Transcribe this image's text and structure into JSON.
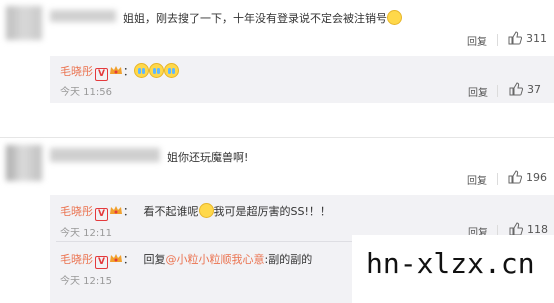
{
  "comments": [
    {
      "text": "姐姐，刚去搜了一下，十年没有登录说不定会被注销号",
      "reply_label": "回复",
      "likes": "311",
      "replies": [
        {
          "nickname": "毛晓彤",
          "colon": "：",
          "time": "今天 11:56",
          "reply_label": "回复",
          "likes": "37",
          "emoji_count": 3
        }
      ]
    },
    {
      "text": "姐你还玩魔兽啊!",
      "reply_label": "回复",
      "likes": "196",
      "replies": [
        {
          "nickname": "毛晓彤",
          "colon": "：",
          "text_before": "看不起谁呢",
          "text_after": "我可是超厉害的SS!！！",
          "time": "今天 12:11",
          "reply_label": "回复",
          "likes": "118"
        },
        {
          "nickname": "毛晓彤",
          "colon": "：",
          "prefix": "回复",
          "mention": "@小粒小粒顺我心意",
          "text_after": ":副的副的",
          "time": "今天 12:15",
          "reply_label": "回复"
        }
      ]
    }
  ],
  "watermark": "hn-xlzx.cn",
  "colors": {
    "nickname": "#eb7350",
    "subbox_bg": "#f2f2f5",
    "meta": "#999999"
  }
}
